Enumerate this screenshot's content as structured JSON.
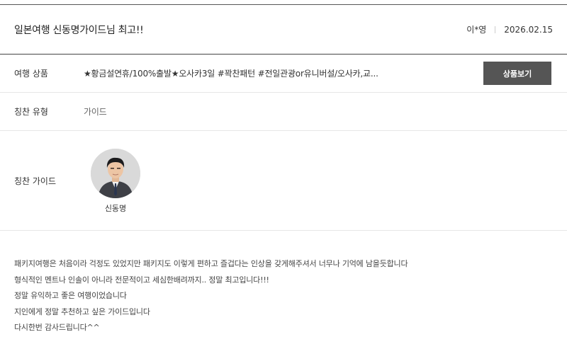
{
  "post": {
    "title": "일본여행 신동명가이드님 최고!!",
    "author": "이*영",
    "date": "2026.02.15"
  },
  "product": {
    "label": "여행 상품",
    "value": "★황금설연휴/100%출발★오사카3일 #꽉찬패턴 #전일관광or유니버설/오사카,교...",
    "button_label": "상품보기"
  },
  "praise_type": {
    "label": "칭찬 유형",
    "value": "가이드"
  },
  "guide": {
    "label": "칭찬 가이드",
    "name": "신동명"
  },
  "content": {
    "lines": [
      "패키지여행은 처음이라 걱정도 있었지만 패키지도 이렇게 편하고 즐겁다는 인상을 갖게해주셔서 너무나 기억에 남을듯합니다",
      "형식적인 멘트나 인솔이 아니라 전문적이고 세심한배려까지.. 정말 최고입니다!!!",
      "정말 유익하고 좋은 여행이었습니다",
      "지인에게 정말 추천하고 싶은 가이드입니다",
      "다시한번 감사드립니다^^"
    ]
  }
}
